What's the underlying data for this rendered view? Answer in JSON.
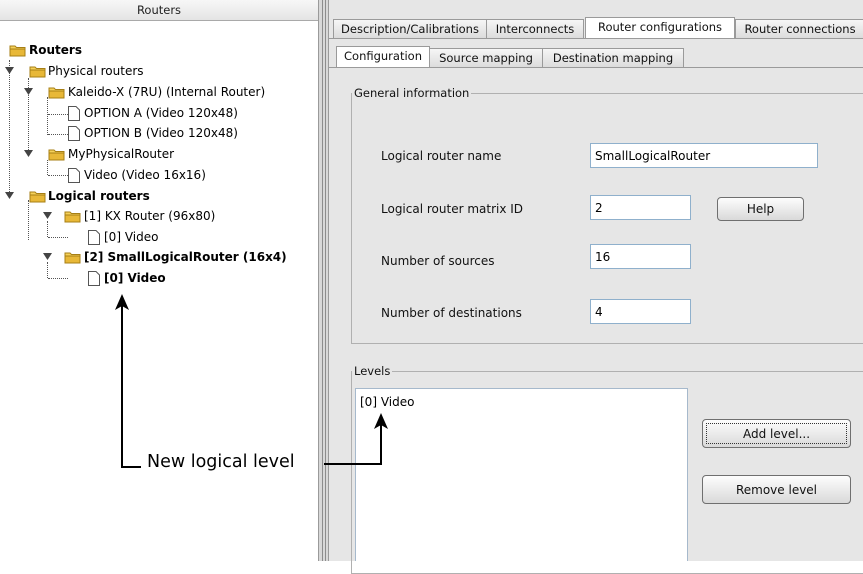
{
  "tree": {
    "header": "Routers",
    "items": [
      {
        "label": "Routers",
        "bold": true,
        "icon": "folder-icon"
      },
      {
        "label": "Physical routers",
        "bold": false,
        "icon": "folder-icon"
      },
      {
        "label": "Kaleido-X (7RU) (Internal Router)",
        "bold": false,
        "icon": "folder-icon"
      },
      {
        "label": "OPTION A (Video 120x48)",
        "bold": false,
        "icon": "file-icon"
      },
      {
        "label": "OPTION B (Video 120x48)",
        "bold": false,
        "icon": "file-icon"
      },
      {
        "label": "MyPhysicalRouter",
        "bold": false,
        "icon": "folder-icon"
      },
      {
        "label": "Video (Video 16x16)",
        "bold": false,
        "icon": "file-icon"
      },
      {
        "label": "Logical routers",
        "bold": true,
        "icon": "folder-icon"
      },
      {
        "label": "[1] KX Router (96x80)",
        "bold": false,
        "icon": "folder-icon"
      },
      {
        "label": "[0] Video",
        "bold": false,
        "icon": "file-icon"
      },
      {
        "label": "[2] SmallLogicalRouter (16x4)",
        "bold": true,
        "icon": "folder-icon"
      },
      {
        "label": "[0] Video",
        "bold": true,
        "icon": "file-icon"
      }
    ]
  },
  "tabs": {
    "main": [
      "Description/Calibrations",
      "Interconnects",
      "Router configurations",
      "Router connections"
    ],
    "main_active": "Router configurations",
    "sub": [
      "Configuration",
      "Source mapping",
      "Destination mapping"
    ],
    "sub_active": "Configuration"
  },
  "general": {
    "legend": "General information",
    "name_label": "Logical router name",
    "name_value": "SmallLogicalRouter",
    "matrix_label": "Logical router matrix ID",
    "matrix_value": "2",
    "help_button": "Help",
    "sources_label": "Number of sources",
    "sources_value": "16",
    "destinations_label": "Number of destinations",
    "destinations_value": "4"
  },
  "levels": {
    "legend": "Levels",
    "items": [
      "[0] Video"
    ],
    "add_button": "Add level...",
    "remove_button": "Remove level"
  },
  "annotation": {
    "label": "New logical level"
  },
  "colors": {
    "folder": "#e8b838",
    "panel_bg": "#e6e6e6",
    "field_border": "#8fb0cc"
  }
}
